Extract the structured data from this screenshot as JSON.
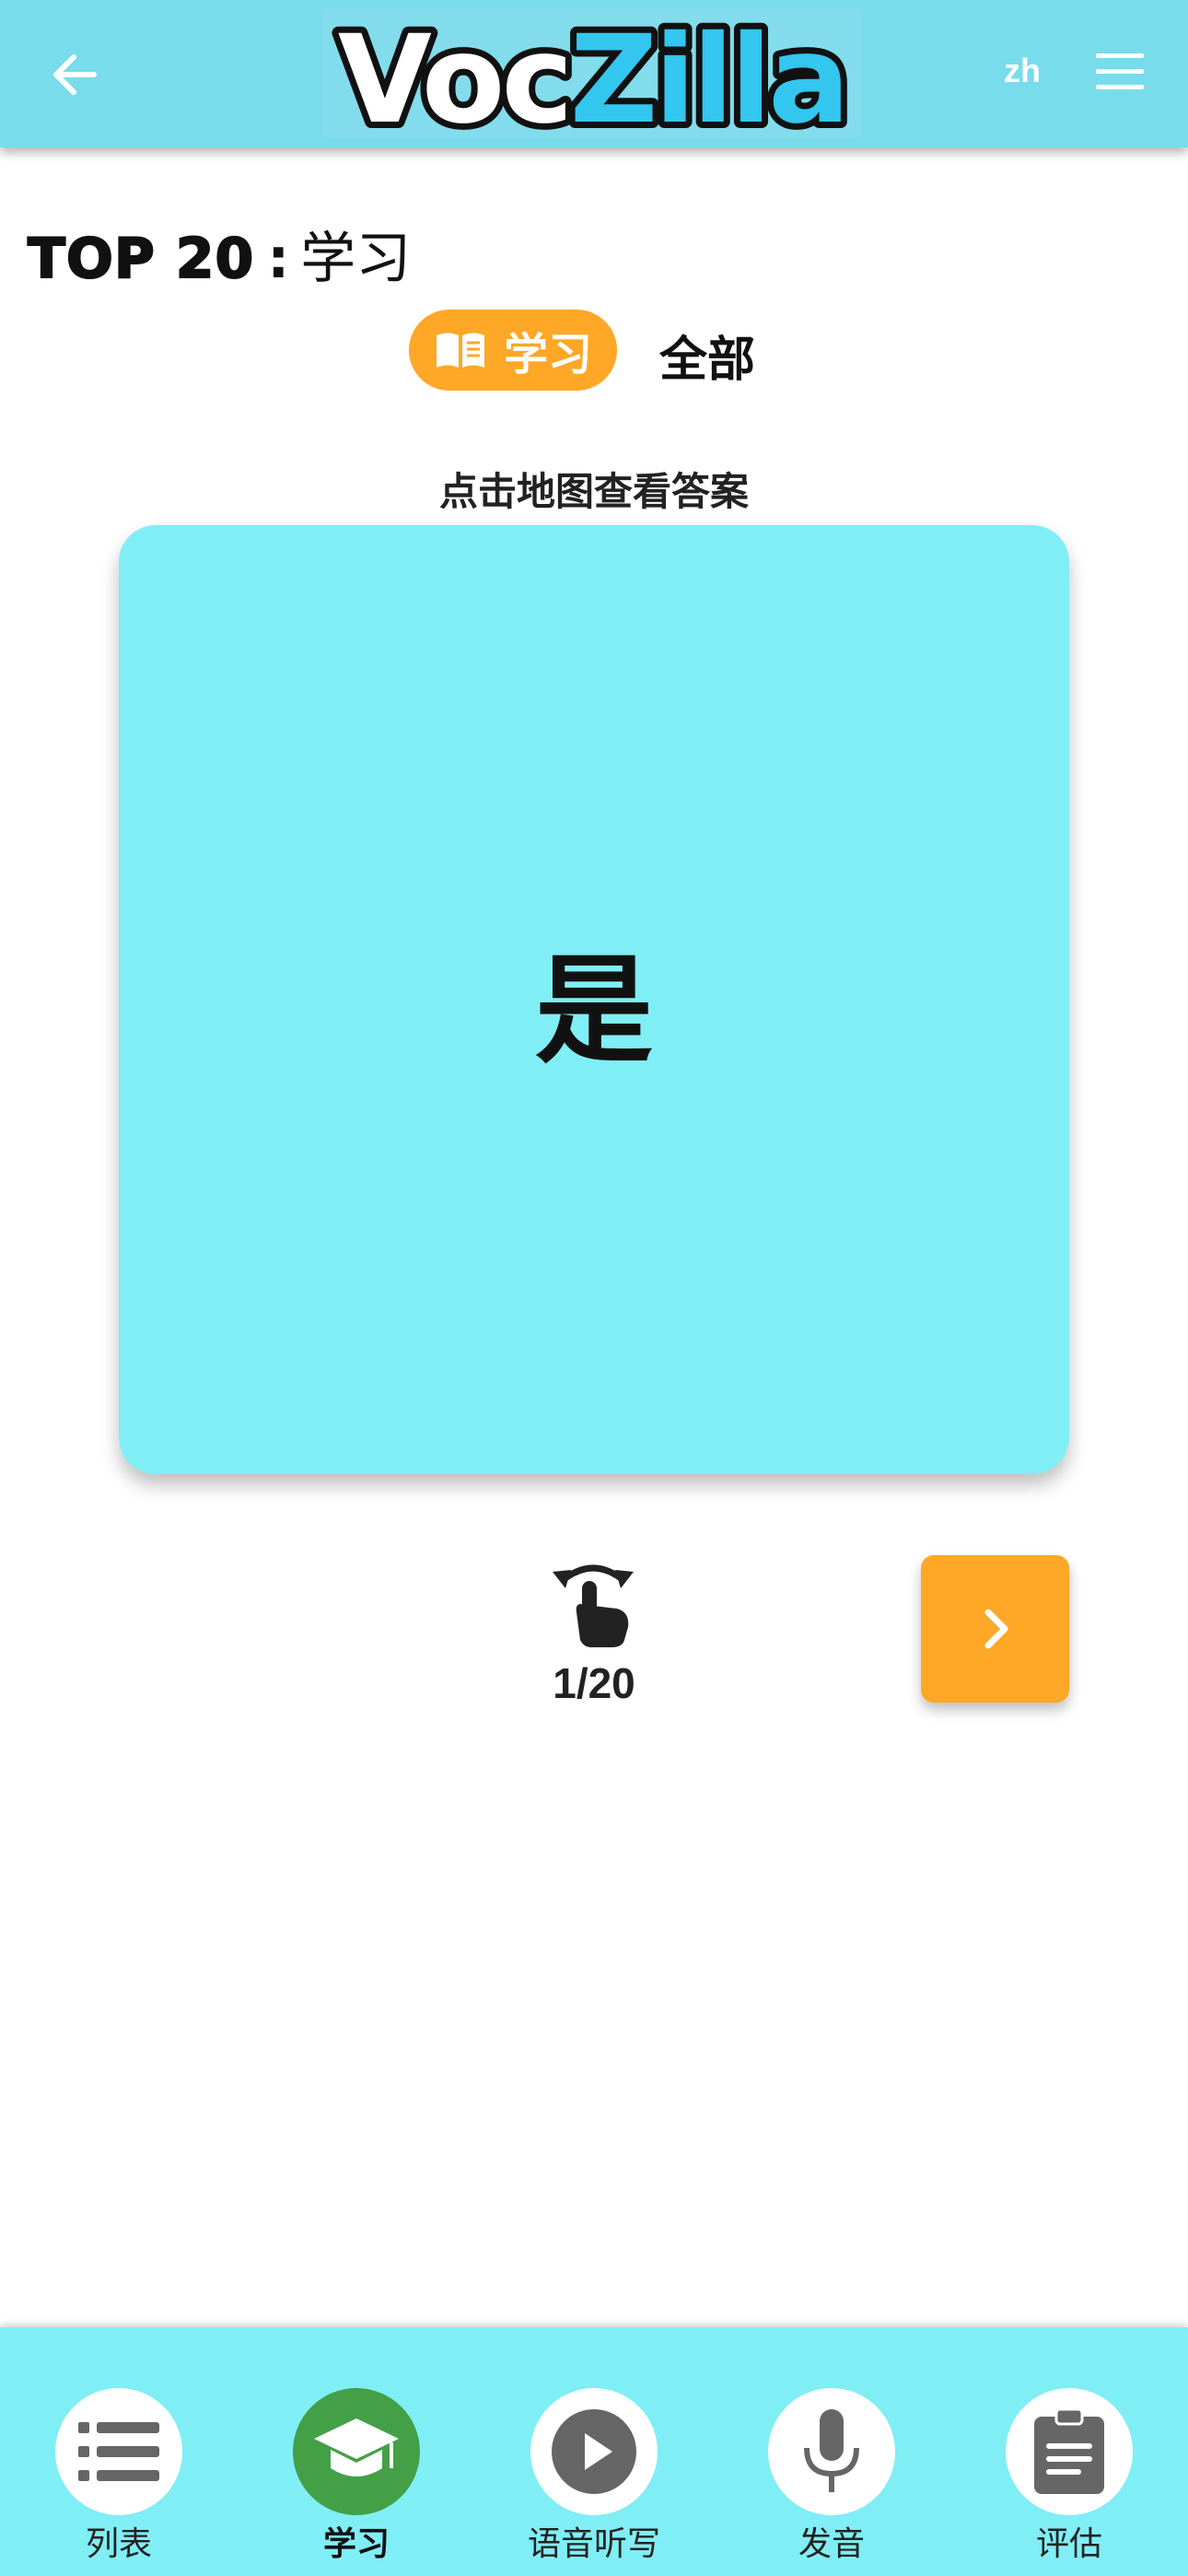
{
  "header": {
    "back_icon": "arrow-left-icon",
    "logo": {
      "part1": "Voc",
      "part2": "Zilla"
    },
    "language": "zh",
    "menu_icon": "hamburger-menu-icon"
  },
  "title": {
    "prefix": "TOP 20",
    "separator": ":",
    "mode": "学习"
  },
  "modes": {
    "active": {
      "label": "学习",
      "icon": "book-icon",
      "color": "#ffa726"
    },
    "other": {
      "label": "全部"
    }
  },
  "flashcard": {
    "hint": "点击地图查看答案",
    "word": "是",
    "background": "#80eef5"
  },
  "controls": {
    "flip_icon": "tap-flip-icon",
    "counter": "1/20",
    "next_icon": "chevron-right-icon"
  },
  "bottom_nav": {
    "items": [
      {
        "label": "列表",
        "icon": "list-icon"
      },
      {
        "label": "学习",
        "icon": "graduation-cap-icon",
        "active": true
      },
      {
        "label": "语音听写",
        "icon": "play-icon"
      },
      {
        "label": "发音",
        "icon": "microphone-icon"
      },
      {
        "label": "评估",
        "icon": "clipboard-icon"
      }
    ]
  },
  "colors": {
    "header_bg": "#78dcec",
    "accent": "#ffa726",
    "active_nav": "#43a047",
    "logo_blue": "#33c6ee"
  }
}
